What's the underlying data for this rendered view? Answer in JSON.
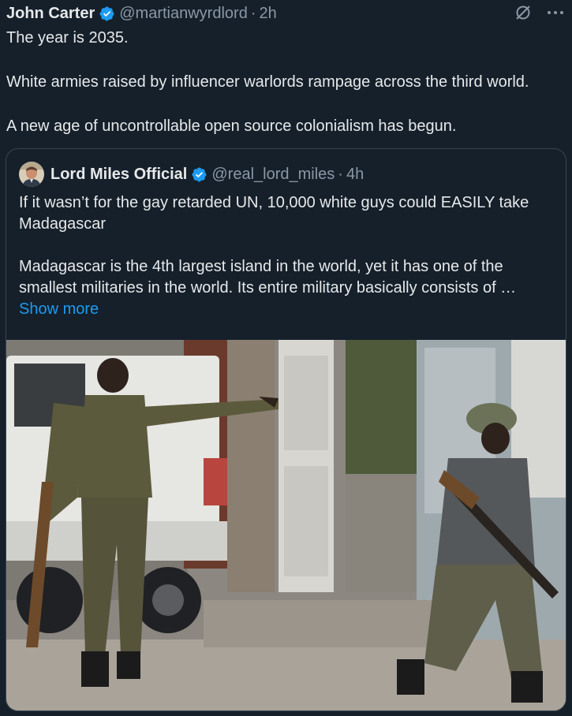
{
  "tweet": {
    "author_name": "John Carter",
    "handle": "@martianwyrdlord",
    "separator": "·",
    "time": "2h",
    "lines": [
      "The year is 2035.",
      "White armies raised by influencer warlords rampage across the third world.",
      "A new age of uncontrollable open source colonialism has begun."
    ],
    "icons": {
      "verified": "verified-badge-icon",
      "grok": "grok-icon",
      "more": "more-options-icon"
    }
  },
  "quote": {
    "author_name": "Lord Miles Official",
    "handle": "@real_lord_miles",
    "separator": "·",
    "time": "4h",
    "paragraph_1": "If it wasn’t for the gay retarded UN, 10,000 white guys could EASILY take Madagascar",
    "paragraph_2": "Madagascar is the 4th largest island in the world, yet it has one of the smallest militaries in the world. Its entire military basically consists of …",
    "show_more": "Show more",
    "media": "photo-two-soldiers-street"
  },
  "colors": {
    "background": "#15202b",
    "text": "#e7e9ea",
    "secondary_text": "#8b98a5",
    "link": "#1d9bf0",
    "verified": "#1d9bf0",
    "border": "#38444d"
  }
}
